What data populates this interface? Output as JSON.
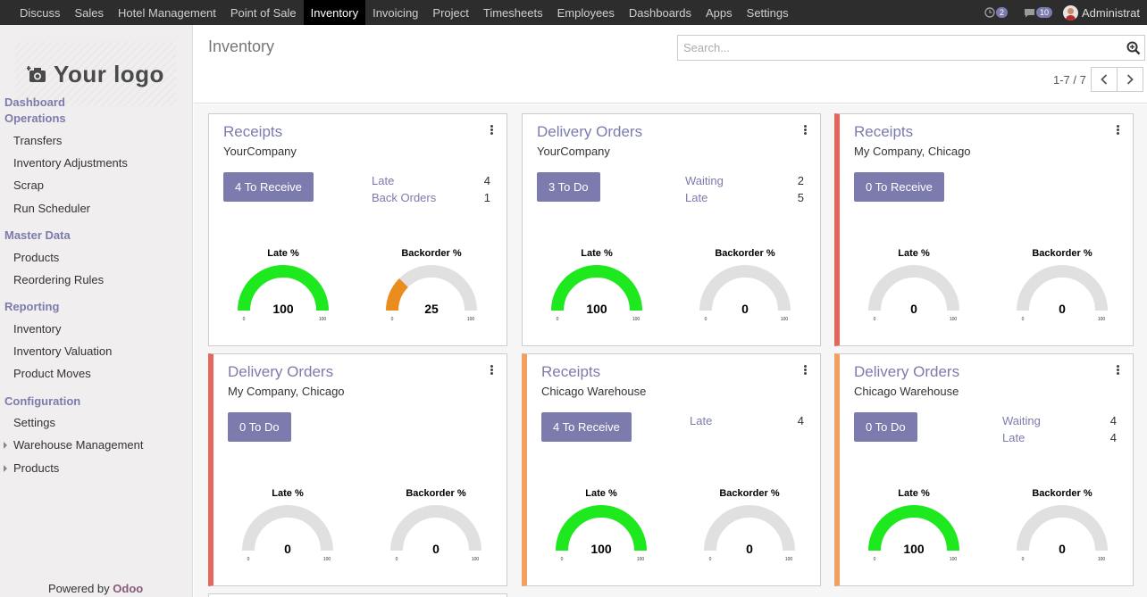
{
  "topbar": {
    "menu": [
      "Discuss",
      "Sales",
      "Hotel Management",
      "Point of Sale",
      "Inventory",
      "Invoicing",
      "Project",
      "Timesheets",
      "Employees",
      "Dashboards",
      "Apps",
      "Settings"
    ],
    "active": "Inventory",
    "activity_count": "2",
    "messages_count": "10",
    "user_name": "Administrat"
  },
  "sidebar": {
    "logo_text": "Your logo",
    "sections": [
      {
        "label": "Dashboard",
        "label2": "Operations",
        "items": [
          "Transfers",
          "Inventory Adjustments",
          "Scrap",
          "Run Scheduler"
        ]
      },
      {
        "label": "Master Data",
        "items": [
          "Products",
          "Reordering Rules"
        ]
      },
      {
        "label": "Reporting",
        "items": [
          "Inventory",
          "Inventory Valuation",
          "Product Moves"
        ]
      },
      {
        "label": "Configuration",
        "items": [
          "Settings",
          "Warehouse Management",
          "Products"
        ]
      }
    ],
    "powered_prefix": "Powered by",
    "powered_brand": "Odoo"
  },
  "control": {
    "title": "Inventory",
    "search_placeholder": "Search...",
    "pager": "1-7 / 7"
  },
  "colors": {
    "accent": "#7c7bad",
    "gauge_green": "#1ee81e",
    "gauge_orange": "#ea8c1e",
    "gauge_bg": "#e0e0e0",
    "border_red": "#e4675d",
    "border_orange": "#f2a060"
  },
  "cards": [
    {
      "title": "Receipts",
      "subtitle": "YourCompany",
      "button": "4 To Receive",
      "stats": [
        {
          "label": "Late",
          "value": "4"
        },
        {
          "label": "Back Orders",
          "value": "1"
        }
      ],
      "late_pct": 100,
      "backorder_pct": 25
    },
    {
      "title": "Delivery Orders",
      "subtitle": "YourCompany",
      "button": "3 To Do",
      "stats": [
        {
          "label": "Waiting",
          "value": "2"
        },
        {
          "label": "Late",
          "value": "5"
        }
      ],
      "late_pct": 100,
      "backorder_pct": 0
    },
    {
      "title": "Receipts",
      "subtitle": "My Company, Chicago",
      "button": "0 To Receive",
      "stats": [],
      "late_pct": 0,
      "backorder_pct": 0
    },
    {
      "title": "Delivery Orders",
      "subtitle": "My Company, Chicago",
      "button": "0 To Do",
      "stats": [],
      "late_pct": 0,
      "backorder_pct": 0
    },
    {
      "title": "Receipts",
      "subtitle": "Chicago Warehouse",
      "button": "4 To Receive",
      "stats": [
        {
          "label": "Late",
          "value": "4"
        }
      ],
      "late_pct": 100,
      "backorder_pct": 0
    },
    {
      "title": "Delivery Orders",
      "subtitle": "Chicago Warehouse",
      "button": "0 To Do",
      "stats": [
        {
          "label": "Waiting",
          "value": "4"
        },
        {
          "label": "Late",
          "value": "4"
        }
      ],
      "late_pct": 100,
      "backorder_pct": 0
    }
  ],
  "gauge_labels": {
    "late": "Late %",
    "backorder": "Backorder %",
    "min": "0",
    "max": "100"
  }
}
